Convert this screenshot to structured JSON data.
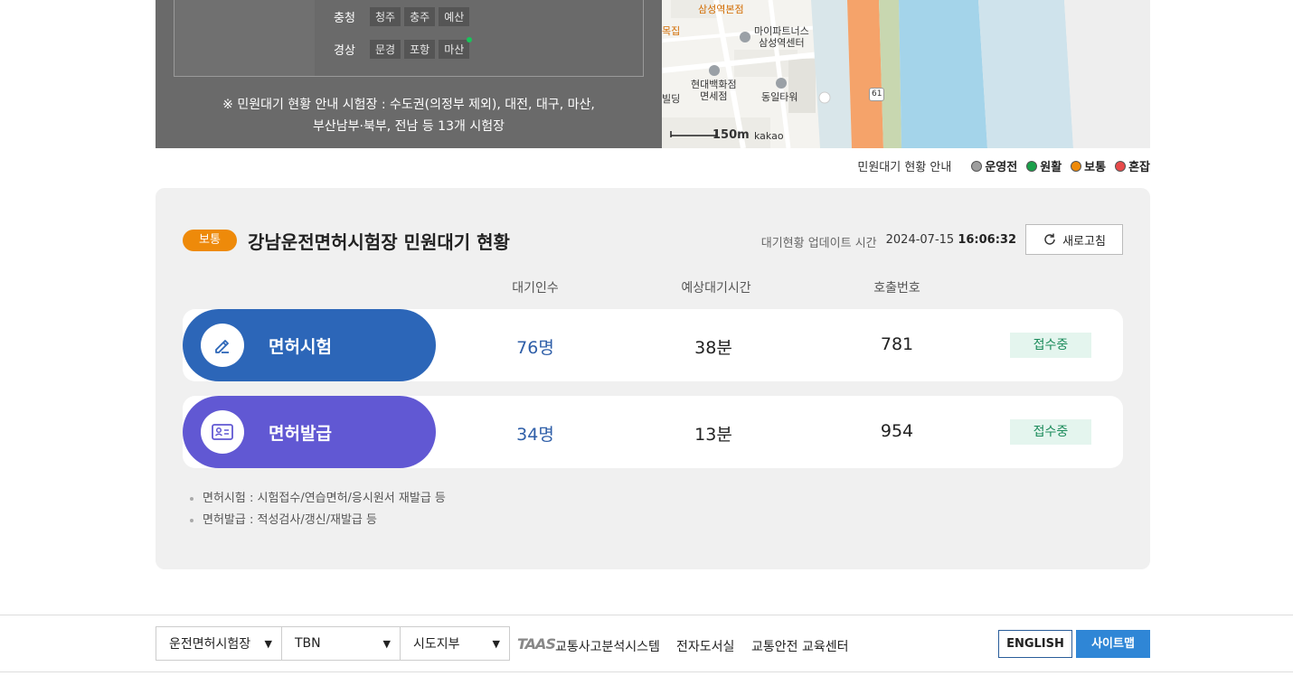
{
  "regions": [
    {
      "label": "충청",
      "chips": [
        "청주",
        "충주",
        "예산"
      ]
    },
    {
      "label": "경상",
      "chips": [
        "문경",
        "포항",
        "마산"
      ]
    }
  ],
  "region_note_line1": "※ 민원대기 현황 안내 시험장 : 수도권(의정부 제외), 대전, 대구, 마산,",
  "region_note_line2": "부산남부·북부, 전남 등 13개 시험장",
  "map": {
    "labels": {
      "samsung_store": "삼성역본점",
      "mokjip": "목집",
      "myapart": "마이파트너스\n삼성역센터",
      "hyundai": "현대백화점\n면세점",
      "dongil": "동일타워",
      "building": "빌딩",
      "road_number": "61",
      "scale": "150m",
      "brand": "kakao"
    }
  },
  "legend": {
    "title": "민원대기 현황 안내",
    "items": [
      {
        "label": "운영전",
        "color": "#9e9e9e"
      },
      {
        "label": "원활",
        "color": "#1aa04a"
      },
      {
        "label": "보통",
        "color": "#ee8a0a"
      },
      {
        "label": "혼잡",
        "color": "#e84a4a"
      }
    ]
  },
  "card": {
    "status_badge": "보통",
    "title": "강남운전면허시험장 민원대기 현황",
    "update_label": "대기현황 업데이트 시간",
    "update_date": "2024-07-15",
    "update_time": "16:06:32",
    "refresh_label": "새로고침",
    "columns": [
      "대기인수",
      "예상대기시간",
      "호출번호"
    ],
    "rows": [
      {
        "name": "면허시험",
        "waiting": "76명",
        "time": "38분",
        "call": "781",
        "status": "접수중",
        "color": "#2c66b8"
      },
      {
        "name": "면허발급",
        "waiting": "34명",
        "time": "13분",
        "call": "954",
        "status": "접수중",
        "color": "#6158d3"
      }
    ],
    "notes": [
      "면허시험 : 시험접수/연습면허/응시원서 재발급 등",
      "면허발급 : 적성검사/갱신/재발급 등"
    ]
  },
  "footer": {
    "selects": [
      "운전면허시험장",
      "TBN",
      "시도지부"
    ],
    "taas_logo": "TAAS",
    "links": [
      "교통사고분석시스템",
      "전자도서실",
      "교통안전 교육센터"
    ],
    "english_btn": "ENGLISH",
    "sitemap_btn": "사이트맵"
  }
}
